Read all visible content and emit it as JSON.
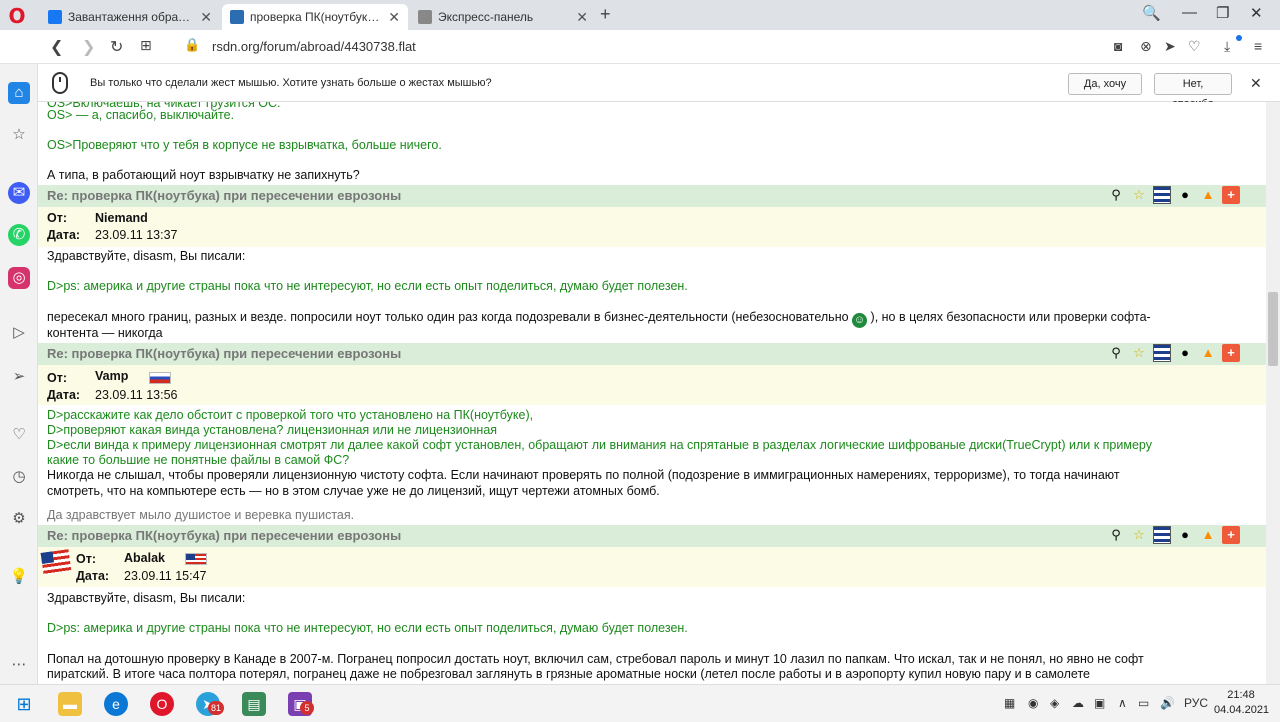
{
  "tabs": [
    {
      "label": "Завантаження образу дис",
      "active": false
    },
    {
      "label": "проверка ПК(ноутбука) пр",
      "active": true
    },
    {
      "label": "Экспресс-панель",
      "active": false
    }
  ],
  "address": {
    "url": "rsdn.org/forum/abroad/4430738.flat"
  },
  "gesture": {
    "text": "Вы только что сделали жест мышью. Хотите узнать больше о жестах мышью?",
    "yes": "Да, хочу",
    "no": "Нет, спасибо"
  },
  "content": {
    "top_lines": {
      "partial": "OS>Включаешь, на чикает грузится OC.",
      "line1": "OS> — а, спасибо, выключайте.",
      "line2": "OS>Проверяют что у тебя в корпусе не взрывчатка, больше ничего.",
      "line3": "А типа, в работающий ноут взрывчатку не запихнуть?"
    },
    "labels": {
      "from": "От:",
      "date": "Дата:"
    },
    "messages": [
      {
        "title": "Re: проверка ПК(ноутбука) при пересечении еврозоны",
        "author": "Niemand",
        "date": "23.09.11 13:37",
        "greeting": "Здравствуйте, disasm, Вы писали:",
        "quote": "D>ps: америка и другие страны пока что не интересуют, но если есть опыт поделиться, думаю будет полезен.",
        "body1": "пересекал много границ, разных и везде. попросили ноут только один раз когда подозревали в бизнес-деятельности (небезосновательно",
        "body1_tail": "), но в целях безопасности или проверки софта-",
        "body2": "контента — никогда"
      },
      {
        "title": "Re: проверка ПК(ноутбука) при пересечении еврозоны",
        "author": "Vamp",
        "date": "23.09.11 13:56",
        "quote1": "D>расскажите как дело обстоит с проверкой того что установлено на ПК(ноутбуке),",
        "quote2": "D>проверяют какая винда установлена? лицензионная или не лицензионная",
        "quote3": "D>если винда к примеру лицензионная смотрят ли далее какой софт установлен, обращают ли внимания на спрятаные в разделах логические шифрованые диски(TrueCrypt) или к примеру",
        "quote4": "какие то большие не понятные файлы в самой ФС?",
        "body1": "Никогда не слышал, чтобы проверяли лицензионную чистоту софта. Если начинают проверять по полной (подозрение в иммиграционных намерениях, терроризме), то тогда начинают",
        "body2": "смотреть, что на компьютере есть — но в этом случае уже не до лицензий, ищут чертежи атомных бомб.",
        "signature": "Да здравствует мыло душистое и веревка пушистая."
      },
      {
        "title": "Re: проверка ПК(ноутбука) при пересечении еврозоны",
        "author": "Abalak",
        "date": "23.09.11 15:47",
        "greeting": "Здравствуйте, disasm, Вы писали:",
        "quote": "D>ps: америка и другие страны пока что не интересуют, но если есть опыт поделиться, думаю будет полезен.",
        "body1": "Попал на дотошную проверку в Канаде в 2007-м. Погранец попросил достать ноут, включил сам, стребовал пароль и минут 10 лазил по папкам. Что искал, так и не понял, но явно не софт",
        "body2": "пиратский. В итоге часа полтора потерял, погранец даже не побрезговал заглянуть в грязные ароматные носки (летел после работы и в аэропорту купил новую пару и в самолете"
      }
    ]
  },
  "taskbar": {
    "telegram_badge": "81",
    "app6_badge": "5",
    "lang": "РУС",
    "time": "21:48",
    "date": "04.04.2021"
  }
}
